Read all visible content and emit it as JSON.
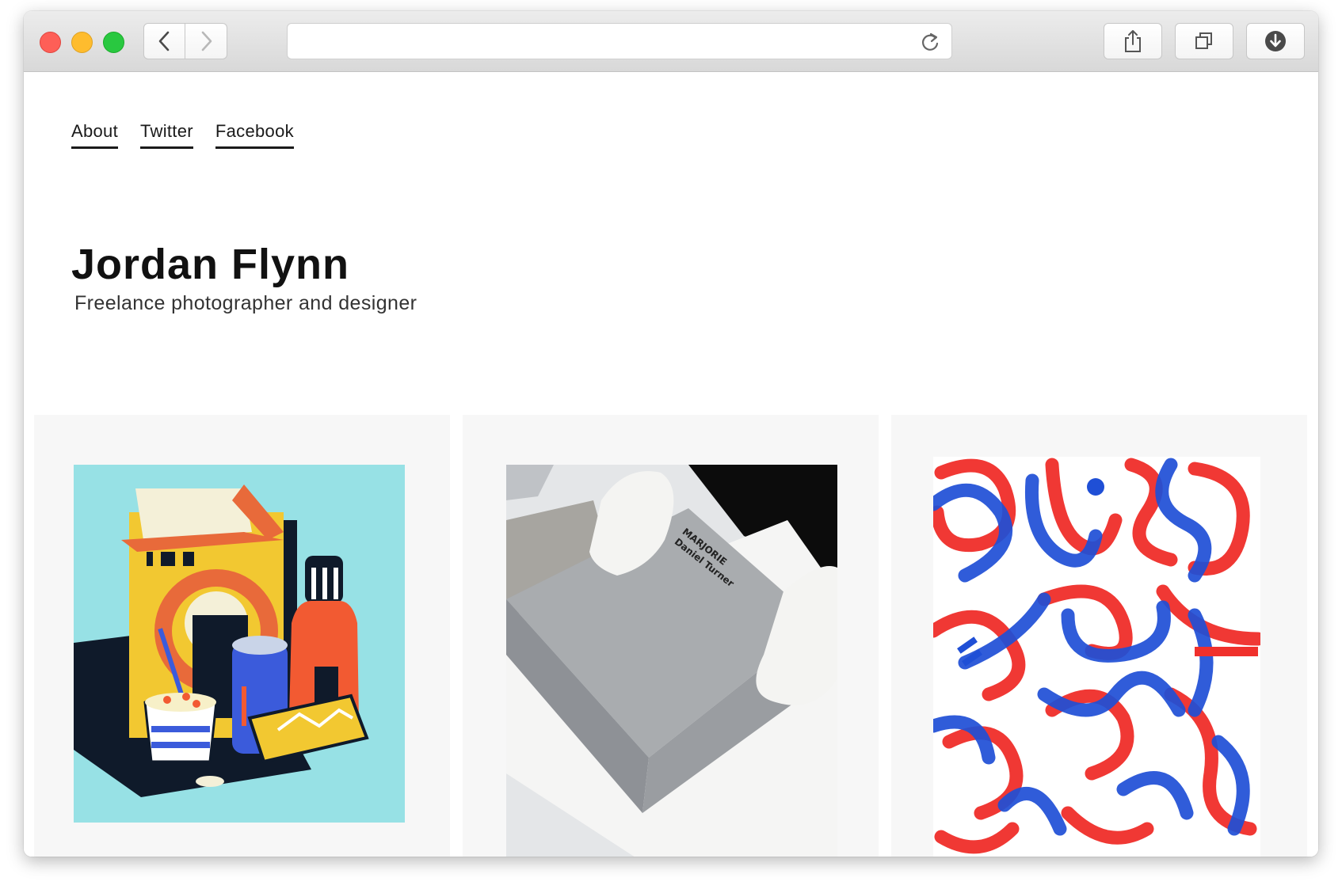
{
  "browser": {
    "address_value": "",
    "icons": [
      "close-light",
      "minimize-light",
      "zoom-light",
      "chevron-left-icon",
      "chevron-right-icon",
      "reload-icon",
      "share-icon",
      "tabs-icon",
      "download-icon"
    ]
  },
  "nav": {
    "items": [
      {
        "label": "About"
      },
      {
        "label": "Twitter"
      },
      {
        "label": "Facebook"
      }
    ]
  },
  "hero": {
    "name": "Jordan Flynn",
    "tagline": "Freelance photographer and designer"
  },
  "projects": {
    "book_title": "MARJORIE",
    "book_author": "Daniel Turner"
  },
  "colors": {
    "accent_red": "#f0302c",
    "accent_blue": "#1f4fd6",
    "illustration_bg": "#97e1e5",
    "card_bg": "#f7f7f7"
  }
}
